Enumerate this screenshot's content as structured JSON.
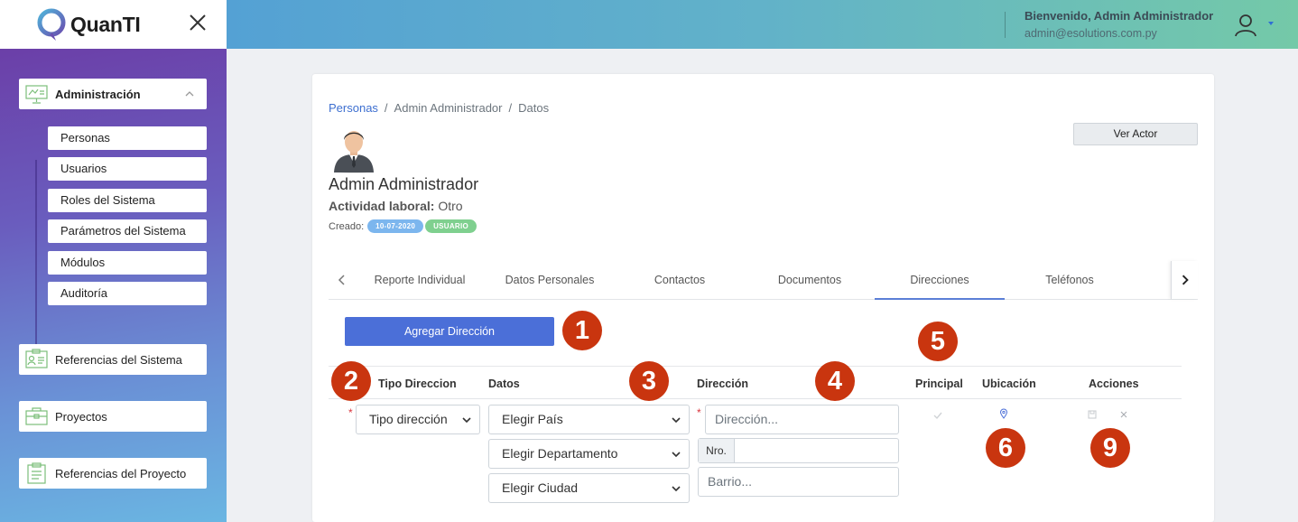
{
  "app": {
    "logo_text": "QuanTI"
  },
  "header": {
    "welcome": "Bienvenido, Admin Administrador",
    "email": "admin@esolutions.com.py"
  },
  "sidebar": {
    "sections": [
      {
        "label": "Administración",
        "expanded": true
      },
      {
        "label": "Referencias del Sistema"
      },
      {
        "label": "Proyectos"
      },
      {
        "label": "Referencias del Proyecto"
      }
    ],
    "sub_items": [
      "Personas",
      "Usuarios",
      "Roles del Sistema",
      "Parámetros del Sistema",
      "Módulos",
      "Auditoría"
    ]
  },
  "breadcrumb": {
    "items": [
      "Personas",
      "Admin Administrador",
      "Datos"
    ],
    "separator": "/"
  },
  "profile": {
    "name": "Admin Administrador",
    "actividad_label": "Actividad laboral:",
    "actividad_value": "Otro",
    "creado_label": "Creado:",
    "creado_date": "10-07-2020",
    "role_badge": "USUARIO",
    "ver_actor_button": "Ver Actor"
  },
  "tabs": {
    "items": [
      "Reporte Individual",
      "Datos Personales",
      "Contactos",
      "Documentos",
      "Direcciones",
      "Teléfonos"
    ],
    "active": "Direcciones"
  },
  "direcciones": {
    "add_button": "Agregar Dirección",
    "columns": [
      "Tipo Direccion",
      "Datos",
      "Dirección",
      "Principal",
      "Ubicación",
      "Acciones"
    ],
    "row": {
      "tipo_select": "Tipo dirección",
      "pais_select": "Elegir País",
      "departamento_select": "Elegir Departamento",
      "ciudad_select": "Elegir Ciudad",
      "direccion_placeholder": "Dirección...",
      "nro_label": "Nro.",
      "barrio_placeholder": "Barrio..."
    }
  },
  "markers": [
    "1",
    "2",
    "3",
    "4",
    "5",
    "6",
    "9"
  ],
  "colors": {
    "primary_button": "#4b6fd8",
    "marker": "#c9350f",
    "badge_date": "#7cb6ee",
    "badge_role": "#7fd08f",
    "link": "#3d6fd0"
  }
}
